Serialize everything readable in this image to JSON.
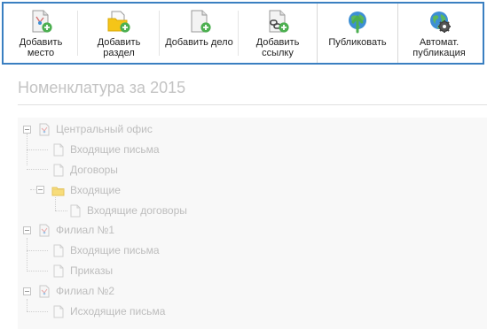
{
  "toolbar": {
    "buttons": [
      {
        "label": "Добавить\nместо",
        "icon": "add-location-icon"
      },
      {
        "label": "Добавить\nраздел",
        "icon": "add-section-icon"
      },
      {
        "label": "Добавить дело",
        "icon": "add-case-icon"
      },
      {
        "label": "Добавить\nссылку",
        "icon": "add-link-icon"
      },
      {
        "label": "Публиковать",
        "icon": "publish-icon"
      },
      {
        "label": "Автомат.\nпубликация",
        "icon": "auto-publish-icon"
      }
    ]
  },
  "page": {
    "title": "Номенклатура за 2015"
  },
  "tree": {
    "nodes": [
      {
        "label": "Центральный офис",
        "type": "location",
        "level": 0
      },
      {
        "label": "Входящие письма",
        "type": "case",
        "level": 1
      },
      {
        "label": "Договоры",
        "type": "case",
        "level": 1
      },
      {
        "label": "Входящие",
        "type": "section",
        "level": 1
      },
      {
        "label": "Входящие договоры",
        "type": "case",
        "level": 2
      },
      {
        "label": "Филиал №1",
        "type": "location",
        "level": 0
      },
      {
        "label": "Входящие письма",
        "type": "case",
        "level": 1
      },
      {
        "label": "Приказы",
        "type": "case",
        "level": 1
      },
      {
        "label": "Филиал №2",
        "type": "location",
        "level": 0
      },
      {
        "label": "Исходящие письма",
        "type": "case",
        "level": 1
      }
    ]
  },
  "colors": {
    "accent_border": "#3a7fc1",
    "plus_green": "#4caf50",
    "folder_yellow": "#f5c518",
    "tree_text": "#bdbdbd"
  }
}
